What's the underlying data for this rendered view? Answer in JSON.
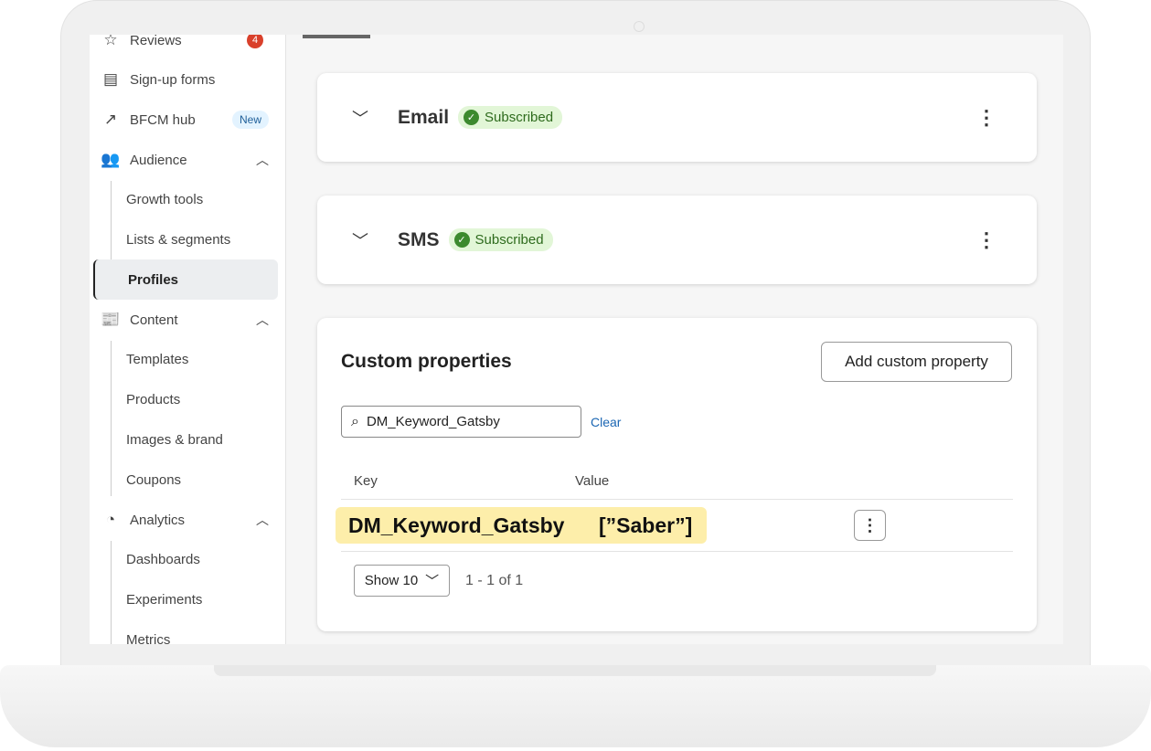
{
  "sidebar": {
    "items": [
      {
        "label": "Reviews",
        "icon": "star-icon",
        "badge": "4"
      },
      {
        "label": "Sign-up forms",
        "icon": "form-icon"
      },
      {
        "label": "BFCM hub",
        "icon": "trend-icon",
        "badge": "New"
      },
      {
        "label": "Audience",
        "icon": "people-icon"
      },
      {
        "label": "Growth tools"
      },
      {
        "label": "Lists & segments"
      },
      {
        "label": "Profiles"
      },
      {
        "label": "Content",
        "icon": "newspaper-icon"
      },
      {
        "label": "Templates"
      },
      {
        "label": "Products"
      },
      {
        "label": "Images & brand"
      },
      {
        "label": "Coupons"
      },
      {
        "label": "Analytics",
        "icon": "pie-chart-icon"
      },
      {
        "label": "Dashboards"
      },
      {
        "label": "Experiments"
      },
      {
        "label": "Metrics"
      }
    ]
  },
  "channels": [
    {
      "title": "Email",
      "status": "Subscribed"
    },
    {
      "title": "SMS",
      "status": "Subscribed"
    }
  ],
  "custom": {
    "title": "Custom properties",
    "add_button": "Add custom property",
    "search_value": "DM_Keyword_Gatsby",
    "clear": "Clear",
    "columns": [
      "Key",
      "Value"
    ],
    "rows": [
      {
        "key": "DM_Keyword_Gatsby",
        "value": "[”Saber”]"
      }
    ],
    "page_size": "Show 10",
    "range": "1 - 1 of 1"
  },
  "colors": {
    "highlight": "#fdeeaa",
    "subscribed_bg": "#e2f6d7",
    "badge_red": "#d9402b"
  }
}
